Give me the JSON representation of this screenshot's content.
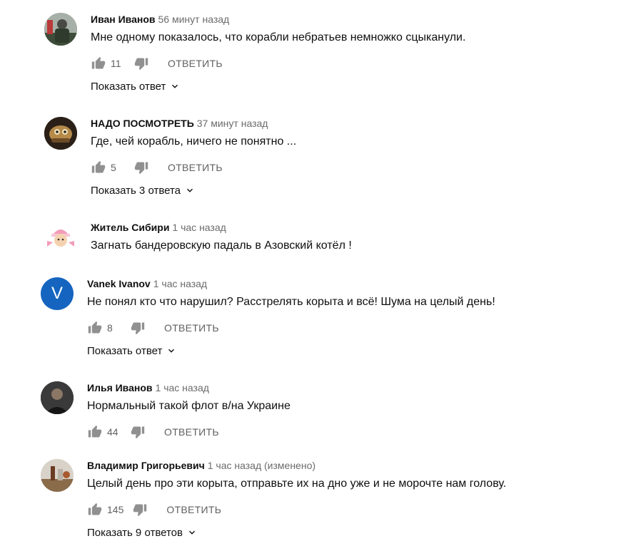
{
  "comments": [
    {
      "author": "Иван Иванов",
      "time": "56 минут назад",
      "text": "Мне одному показалось, что корабли небратьев немножко сцыканули.",
      "likes": "11",
      "reply_label": "ОТВЕТИТЬ",
      "replies_label": "Показать ответ",
      "avatar_icon": "soldier-photo-avatar"
    },
    {
      "author": "НАДО ПОСМОТРЕТЬ",
      "time": "37 минут назад",
      "text": "Где, чей корабль, ничего не понятно ...",
      "likes": "5",
      "reply_label": "ОТВЕТИТЬ",
      "replies_label": "Показать 3 ответа",
      "avatar_icon": "cartoon-avatar"
    },
    {
      "author": "Житель Сибири",
      "time": "1 час назад",
      "text": "Загнать бандеровскую падаль в Азовский котёл !",
      "avatar_icon": "pink-hat-child-avatar"
    },
    {
      "author": "Vanek Ivanov",
      "time": "1 час назад",
      "text": "Не  понял кто что нарушил? Расстрелять корыта и всё! Шума на целый день!",
      "likes": "8",
      "reply_label": "ОТВЕТИТЬ",
      "replies_label": "Показать ответ",
      "avatar_letter": "V",
      "avatar_color": "#1565c0"
    },
    {
      "author": "Илья Иванов",
      "time": "1 час назад",
      "text": "Нормальный такой флот в/на Украине",
      "likes": "44",
      "reply_label": "ОТВЕТИТЬ",
      "avatar_icon": "man-portrait-avatar"
    },
    {
      "author": "Владимир Григорьевич",
      "time": "1 час назад (изменено)",
      "text": "Целый день про эти корыта, отправьте их на дно уже и не морочте нам голову.",
      "likes": "145",
      "reply_label": "ОТВЕТИТЬ",
      "replies_label": "Показать 9 ответов",
      "avatar_icon": "table-photo-avatar"
    }
  ],
  "colors": {
    "text_primary": "#0f0f0f",
    "text_secondary": "#606060",
    "avatar_v": "#1565c0"
  }
}
